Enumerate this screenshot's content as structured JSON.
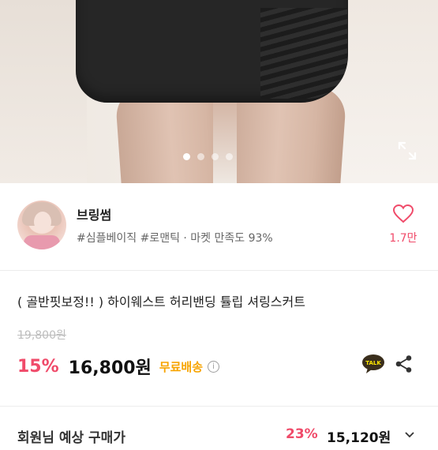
{
  "gallery": {
    "dot_count": 4,
    "active_index": 0,
    "expand_icon": "expand-icon"
  },
  "seller": {
    "name": "브링썸",
    "tags": "#심플베이직 #로맨틱 · 마켓 만족도 93%",
    "likes": "1.7만",
    "heart_icon": "heart-icon"
  },
  "product": {
    "title": "( 골반핏보정!! ) 하이웨스트 허리밴딩 튤립 셔링스커트",
    "original_price": "19,800원",
    "discount": "15%",
    "price": "16,800원",
    "shipping": "무료배송",
    "info_icon": "info-icon",
    "talk_icon": "kakaotalk-icon",
    "talk_label": "TALK",
    "share_icon": "share-icon"
  },
  "member": {
    "label": "회원님 예상 구매가",
    "discount": "23%",
    "price": "15,120원",
    "chevron_icon": "chevron-down-icon"
  },
  "colors": {
    "accent": "#f04b6a",
    "shipping": "#f7a400",
    "kakao_yellow": "#fee500"
  }
}
